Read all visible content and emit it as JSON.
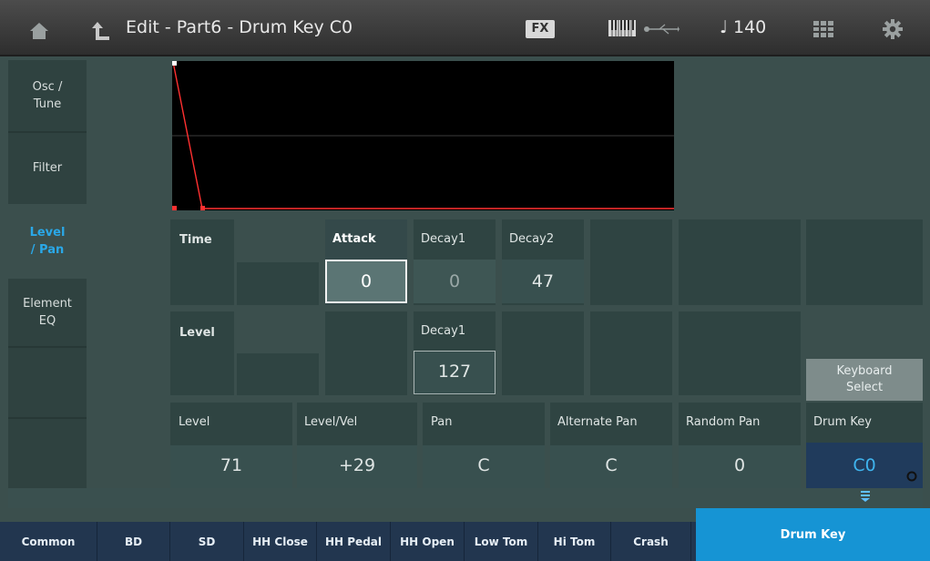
{
  "header": {
    "title": "Edit - Part6 - Drum Key C0",
    "fx_label": "FX",
    "tempo": "♩ 140"
  },
  "nav": {
    "items": [
      {
        "label": "Osc /\nTune",
        "active": false
      },
      {
        "label": "Filter",
        "active": false
      },
      {
        "label": "Level\n/ Pan",
        "active": true
      },
      {
        "label": "Element\nEQ",
        "active": false
      },
      {
        "label": "",
        "active": false
      },
      {
        "label": "",
        "active": false
      }
    ]
  },
  "envelope": {
    "time": {
      "label": "Time",
      "attack_label": "Attack",
      "attack": "0",
      "decay1_label": "Decay1",
      "decay1": "0",
      "decay2_label": "Decay2",
      "decay2": "47"
    },
    "level": {
      "label": "Level",
      "decay1_label": "Decay1",
      "decay1": "127"
    }
  },
  "params": {
    "level": {
      "label": "Level",
      "value": "71"
    },
    "level_vel": {
      "label": "Level/Vel",
      "value": "+29"
    },
    "pan": {
      "label": "Pan",
      "value": "C"
    },
    "alternate_pan": {
      "label": "Alternate Pan",
      "value": "C"
    },
    "random_pan": {
      "label": "Random Pan",
      "value": "0"
    },
    "drum_key": {
      "label": "Drum Key",
      "value": "C0"
    }
  },
  "keyboard_select": {
    "label": "Keyboard\nSelect"
  },
  "tabs": [
    "Common",
    "BD",
    "SD",
    "HH Close",
    "HH Pedal",
    "HH Open",
    "Low Tom",
    "Hi Tom",
    "Crash",
    "Drum Key"
  ],
  "colors": {
    "accent": "#1694d4",
    "nav_active": "#2aa8e8",
    "envelope_line": "#ff3030"
  }
}
